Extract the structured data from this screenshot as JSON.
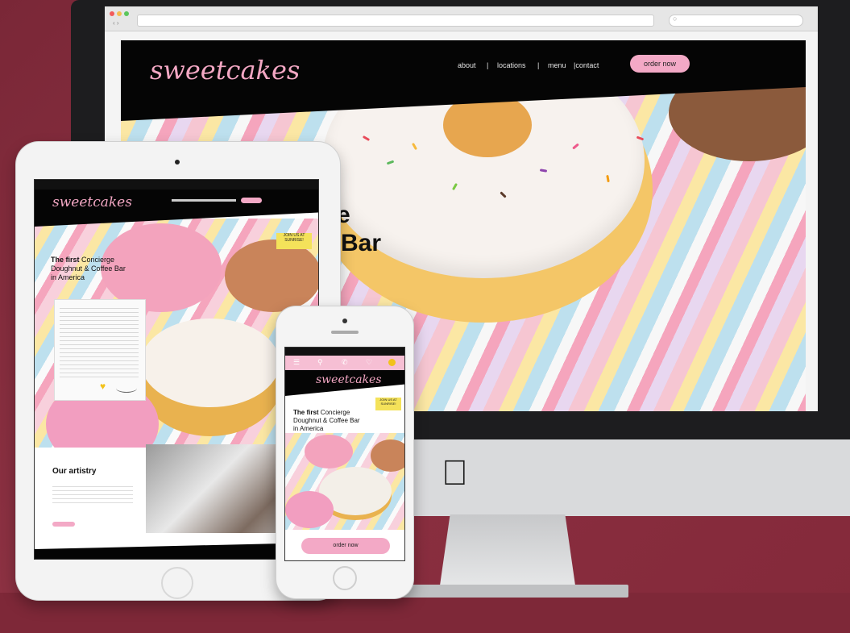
{
  "desktop": {
    "logo": "sweetcakes",
    "nav": [
      "about",
      "|",
      "locations",
      "|",
      "menu",
      "|contact"
    ],
    "order_button": "order now",
    "hero_line1": "e",
    "hero_line2": "e Bar"
  },
  "tablet": {
    "logo": "sweetcakes",
    "sticker": "JOIN US AT SUNRISE!",
    "headline_bold": "The first",
    "headline_rest1": "Concierge",
    "headline_line2": "Doughnut & Coffee Bar",
    "headline_line3": "in America",
    "section_title": "Our artistry"
  },
  "phone": {
    "logo": "sweetcakes",
    "sticker": "JOIN US AT SUNRISE!",
    "headline_bold": "The first",
    "headline_rest1": "Concierge",
    "headline_line2": "Doughnut & Coffee Bar",
    "headline_line3": "in America",
    "order_button": "order now"
  },
  "colors": {
    "background": "#8a2f3f",
    "brand_pink": "#f3a9c6",
    "header_black": "#050505"
  }
}
